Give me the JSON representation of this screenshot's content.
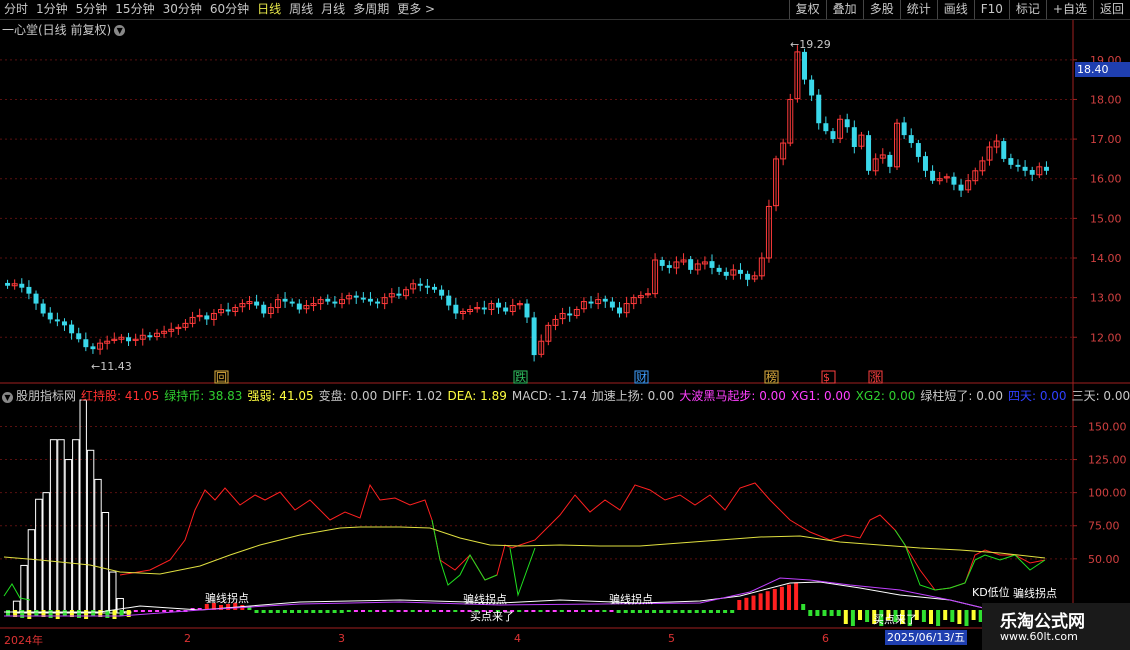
{
  "toolbar": {
    "periods": [
      "分时",
      "1分钟",
      "5分钟",
      "15分钟",
      "30分钟",
      "60分钟",
      "日线",
      "周线",
      "月线",
      "多周期",
      "更多 >"
    ],
    "active_index": 6,
    "right_buttons": [
      "复权",
      "叠加",
      "多股",
      "统计",
      "画线",
      "F10",
      "标记",
      "+自选",
      "返回"
    ]
  },
  "title": {
    "text": "一心堂(日线 前复权)"
  },
  "price_axis": [
    "19.00",
    "18.00",
    "17.00",
    "16.00",
    "15.00",
    "14.00",
    "13.00",
    "12.00"
  ],
  "current_price": "18.40",
  "high_label": "19.29",
  "low_label": "11.43",
  "signals": [
    {
      "text": "回",
      "color": "#e0b040"
    },
    {
      "text": "跌",
      "color": "#30c060"
    },
    {
      "text": "财",
      "color": "#40a0ff"
    },
    {
      "text": "榜",
      "color": "#e0b040"
    },
    {
      "text": "$",
      "color": "#ff4040"
    },
    {
      "text": "涨",
      "color": "#ff4040"
    }
  ],
  "indicator": {
    "name": "股朋指标网",
    "items": [
      {
        "label": "红持股: 41.05",
        "color": "#ff3030"
      },
      {
        "label": "绿持币: 38.83",
        "color": "#30d030"
      },
      {
        "label": "强弱: 41.05",
        "color": "#ffff40"
      },
      {
        "label": "变盘: 0.00",
        "color": "#c8c8c8"
      },
      {
        "label": "DIFF: 1.02",
        "color": "#c8c8c8"
      },
      {
        "label": "DEA: 1.89",
        "color": "#ffff40"
      },
      {
        "label": "MACD: -1.74",
        "color": "#c8c8c8"
      },
      {
        "label": "加速上扬: 0.00",
        "color": "#c8c8c8"
      },
      {
        "label": "大波黑马起步: 0.00",
        "color": "#ff40ff"
      },
      {
        "label": "XG1: 0.00",
        "color": "#ff40ff"
      },
      {
        "label": "XG2: 0.00",
        "color": "#30d030"
      },
      {
        "label": "绿柱短了: 0.00",
        "color": "#c8c8c8"
      },
      {
        "label": "四天: 0.00",
        "color": "#3040ff"
      },
      {
        "label": "三天: 0.00",
        "color": "#c8c8c8"
      }
    ]
  },
  "indicator_axis": [
    "150.00",
    "125.00",
    "100.00",
    "75.00",
    "50.00"
  ],
  "indicator_labels": [
    "骗线拐点",
    "骗线拐点",
    "骗线拐点",
    "骗线拐点",
    "买点来了",
    "买点来了",
    "KD低位"
  ],
  "time_axis": {
    "year": "2024年",
    "months": [
      "2",
      "3",
      "4",
      "5",
      "6"
    ],
    "date_tag": "2025/06/13/五"
  },
  "watermark": {
    "line1": "乐淘公式网",
    "line2": "www.60lt.com"
  },
  "chart_data": {
    "type": "candlestick",
    "title": "一心堂(日线 前复权)",
    "ylim": [
      11.3,
      19.5
    ],
    "close": [
      13.3,
      13.35,
      13.25,
      13.1,
      12.85,
      12.6,
      12.45,
      12.4,
      12.3,
      12.1,
      11.95,
      11.75,
      11.7,
      11.85,
      11.9,
      11.95,
      12.0,
      11.9,
      11.95,
      12.05,
      12.0,
      12.1,
      12.15,
      12.2,
      12.25,
      12.35,
      12.5,
      12.55,
      12.45,
      12.6,
      12.7,
      12.65,
      12.75,
      12.85,
      12.9,
      12.8,
      12.6,
      12.75,
      12.95,
      12.9,
      12.85,
      12.7,
      12.8,
      12.85,
      12.95,
      12.9,
      12.85,
      12.95,
      13.05,
      13.0,
      12.95,
      12.9,
      12.85,
      13.0,
      13.1,
      13.05,
      13.2,
      13.35,
      13.3,
      13.25,
      13.2,
      13.05,
      12.8,
      12.6,
      12.65,
      12.7,
      12.75,
      12.7,
      12.85,
      12.75,
      12.65,
      12.8,
      12.85,
      12.5,
      11.55,
      11.9,
      12.3,
      12.45,
      12.6,
      12.55,
      12.7,
      12.9,
      12.85,
      12.95,
      12.9,
      12.75,
      12.6,
      12.85,
      13.0,
      13.05,
      13.1,
      13.95,
      13.8,
      13.75,
      13.9,
      13.95,
      13.7,
      13.85,
      13.9,
      13.75,
      13.65,
      13.55,
      13.7,
      13.6,
      13.45,
      13.55,
      14.0,
      15.3,
      16.5,
      16.9,
      18.0,
      19.2,
      18.5,
      18.1,
      17.4,
      17.2,
      17.0,
      17.5,
      17.3,
      16.8,
      17.1,
      16.2,
      16.5,
      16.6,
      16.3,
      17.4,
      17.1,
      16.9,
      16.55,
      16.2,
      15.95,
      16.0,
      16.05,
      15.85,
      15.7,
      15.95,
      16.2,
      16.45,
      16.8,
      16.95,
      16.5,
      16.35,
      16.3,
      16.2,
      16.1,
      16.3,
      16.2
    ]
  }
}
